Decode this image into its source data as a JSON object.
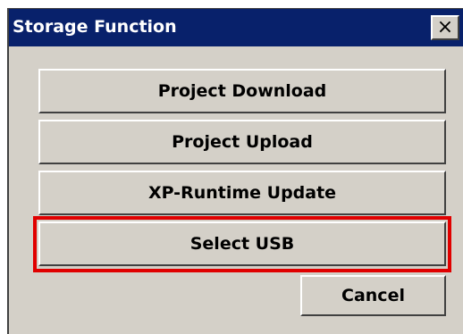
{
  "dialog": {
    "title": "Storage Function",
    "close_label": "×"
  },
  "buttons": [
    {
      "label": "Project Download"
    },
    {
      "label": "Project Upload"
    },
    {
      "label": "XP-Runtime Update"
    },
    {
      "label": "Select USB"
    }
  ],
  "cancel_label": "Cancel",
  "highlight": {
    "target": "Select USB",
    "color": "#e00000"
  },
  "colors": {
    "titlebar": "#08216b",
    "face": "#d4d0c8"
  }
}
